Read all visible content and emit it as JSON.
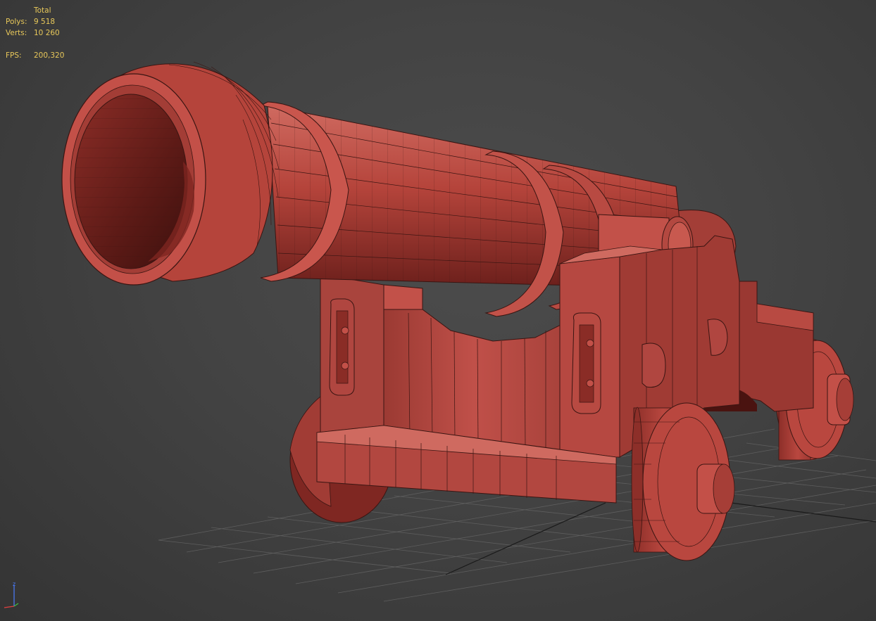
{
  "viewport": {
    "stats": {
      "header": "Total",
      "polys_label": "Polys:",
      "polys_value": "9 518",
      "verts_label": "Verts:",
      "verts_value": "10 260",
      "fps_label": "FPS:",
      "fps_value": "200,320"
    },
    "axis_gizmo": {
      "z_label": "z"
    }
  },
  "colors": {
    "background": "#434343",
    "stats_text": "#e8c85a",
    "model_fill": "#b5443b",
    "model_shadow": "#6b1f1b",
    "model_highlight": "#cf6a60",
    "wire": "#3a1512",
    "grid": "#5e5e5e",
    "grid_axis": "#1a1a1a"
  },
  "icons": {
    "gizmo": "axis-tripod-icon"
  }
}
